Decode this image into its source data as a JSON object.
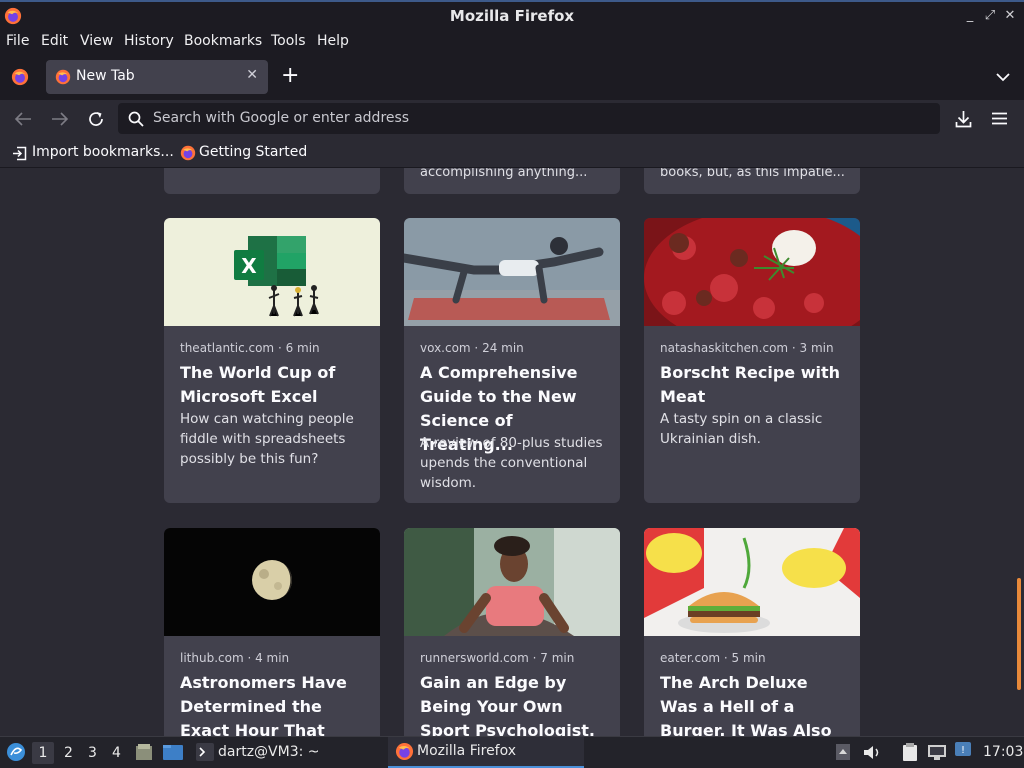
{
  "window": {
    "title": "Mozilla Firefox",
    "controls": [
      "_",
      "⤢",
      "✕"
    ]
  },
  "menu": [
    "File",
    "Edit",
    "View",
    "History",
    "Bookmarks",
    "Tools",
    "Help"
  ],
  "tab": {
    "title": "New Tab",
    "close": "✕",
    "new_tab": "+"
  },
  "urlbar": {
    "placeholder": "Search with Google or enter address"
  },
  "bookmarks": [
    {
      "label": "Import bookmarks..."
    },
    {
      "label": "Getting Started"
    }
  ],
  "top_cards": [
    {
      "text": ""
    },
    {
      "text": "accomplishing anything..."
    },
    {
      "text": "books, but, as this impatie..."
    }
  ],
  "stories": [
    {
      "source": "theatlantic.com · 6 min",
      "title": "The World Cup of Microsoft Excel",
      "desc": "How can watching people fiddle with spreadsheets possibly be this fun?"
    },
    {
      "source": "vox.com · 24 min",
      "title": "A Comprehensive Guide to the New Science of Treating...",
      "desc": "A review of 80-plus studies upends the conventional wisdom."
    },
    {
      "source": "natashaskitchen.com · 3 min",
      "title": "Borscht Recipe with Meat",
      "desc": "A tasty spin on a classic Ukrainian dish."
    },
    {
      "source": "lithub.com · 4 min",
      "title": "Astronomers Have Determined the Exact Hour That Marv...",
      "desc": ""
    },
    {
      "source": "runnersworld.com · 7 min",
      "title": "Gain an Edge by Being Your Own Sport Psychologist. Here’s...",
      "desc": ""
    },
    {
      "source": "eater.com · 5 min",
      "title": "The Arch Deluxe Was a Hell of a Burger. It Was Also McDonald’...",
      "desc": ""
    }
  ],
  "taskbar": {
    "workspaces": [
      "1",
      "2",
      "3",
      "4"
    ],
    "terminal_label": "dartz@VM3: ~",
    "firefox_label": "Mozilla Firefox",
    "clock": "17:03"
  }
}
